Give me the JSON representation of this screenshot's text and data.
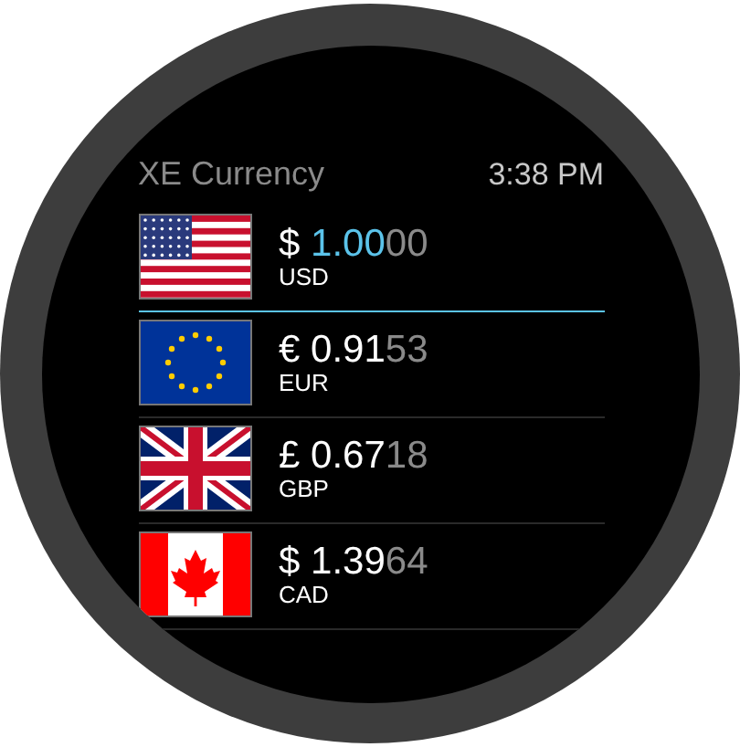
{
  "app": {
    "title": "XE Currency",
    "time": "3:38 PM"
  },
  "currencies": [
    {
      "kind": "us",
      "symbol": "$",
      "amount": "1.00",
      "extra_digits": "00",
      "code": "USD",
      "selected": true
    },
    {
      "kind": "eu",
      "symbol": "€",
      "amount": "0.91",
      "extra_digits": "53",
      "code": "EUR",
      "selected": false
    },
    {
      "kind": "gb",
      "symbol": "£",
      "amount": "0.67",
      "extra_digits": "18",
      "code": "GBP",
      "selected": false
    },
    {
      "kind": "ca",
      "symbol": "$",
      "amount": "1.39",
      "extra_digits": "64",
      "code": "CAD",
      "selected": false
    }
  ]
}
